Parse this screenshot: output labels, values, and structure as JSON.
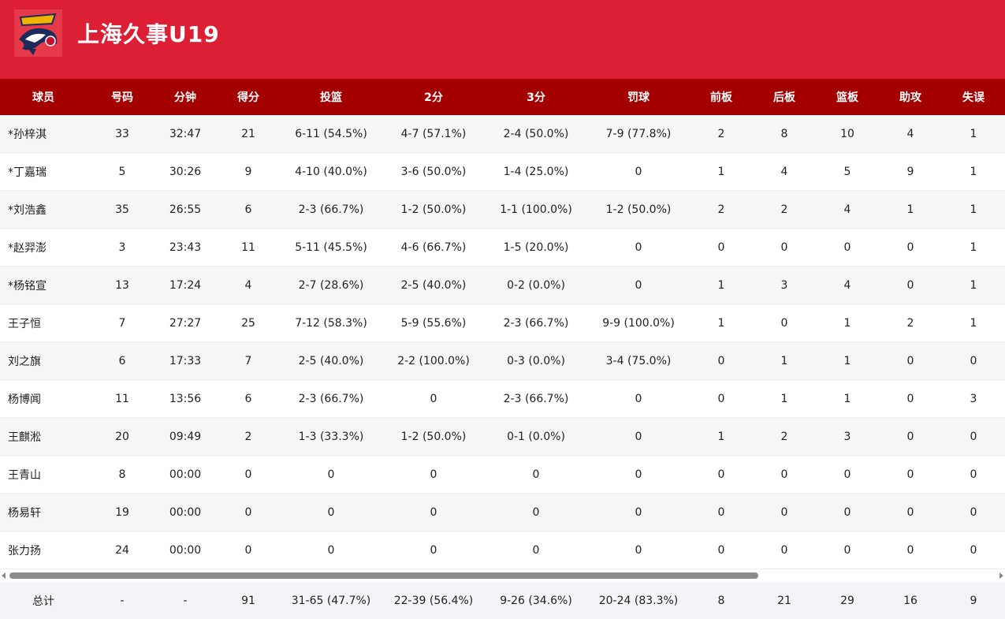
{
  "team": {
    "name": "上海久事U19",
    "logo_icon": "shark-logo-icon",
    "colors": {
      "header": "#dc1f34",
      "table_header": "#a40000"
    }
  },
  "columns": [
    "球员",
    "号码",
    "分钟",
    "得分",
    "投篮",
    "2分",
    "3分",
    "罚球",
    "前板",
    "后板",
    "篮板",
    "助攻",
    "失误"
  ],
  "players": [
    [
      "*孙梓淇",
      "33",
      "32:47",
      "21",
      "6-11 (54.5%)",
      "4-7 (57.1%)",
      "2-4 (50.0%)",
      "7-9 (77.8%)",
      "2",
      "8",
      "10",
      "4",
      "1"
    ],
    [
      "*丁嘉瑞",
      "5",
      "30:26",
      "9",
      "4-10 (40.0%)",
      "3-6 (50.0%)",
      "1-4 (25.0%)",
      "0",
      "1",
      "4",
      "5",
      "9",
      "1"
    ],
    [
      "*刘浩鑫",
      "35",
      "26:55",
      "6",
      "2-3 (66.7%)",
      "1-2 (50.0%)",
      "1-1 (100.0%)",
      "1-2 (50.0%)",
      "2",
      "2",
      "4",
      "1",
      "1"
    ],
    [
      "*赵羿澎",
      "3",
      "23:43",
      "11",
      "5-11 (45.5%)",
      "4-6 (66.7%)",
      "1-5 (20.0%)",
      "0",
      "0",
      "0",
      "0",
      "0",
      "1"
    ],
    [
      "*杨铭宣",
      "13",
      "17:24",
      "4",
      "2-7 (28.6%)",
      "2-5 (40.0%)",
      "0-2 (0.0%)",
      "0",
      "1",
      "3",
      "4",
      "0",
      "1"
    ],
    [
      "王子恒",
      "7",
      "27:27",
      "25",
      "7-12 (58.3%)",
      "5-9 (55.6%)",
      "2-3 (66.7%)",
      "9-9 (100.0%)",
      "1",
      "0",
      "1",
      "2",
      "1"
    ],
    [
      "刘之旗",
      "6",
      "17:33",
      "7",
      "2-5 (40.0%)",
      "2-2 (100.0%)",
      "0-3 (0.0%)",
      "3-4 (75.0%)",
      "0",
      "1",
      "1",
      "0",
      "0"
    ],
    [
      "杨博闻",
      "11",
      "13:56",
      "6",
      "2-3 (66.7%)",
      "0",
      "2-3 (66.7%)",
      "0",
      "0",
      "1",
      "1",
      "0",
      "3"
    ],
    [
      "王麒淞",
      "20",
      "09:49",
      "2",
      "1-3 (33.3%)",
      "1-2 (50.0%)",
      "0-1 (0.0%)",
      "0",
      "1",
      "2",
      "3",
      "0",
      "0"
    ],
    [
      "王青山",
      "8",
      "00:00",
      "0",
      "0",
      "0",
      "0",
      "0",
      "0",
      "0",
      "0",
      "0",
      "0"
    ],
    [
      "杨易轩",
      "19",
      "00:00",
      "0",
      "0",
      "0",
      "0",
      "0",
      "0",
      "0",
      "0",
      "0",
      "0"
    ],
    [
      "张力扬",
      "24",
      "00:00",
      "0",
      "0",
      "0",
      "0",
      "0",
      "0",
      "0",
      "0",
      "0",
      "0"
    ]
  ],
  "totals": [
    "总计",
    "-",
    "-",
    "91",
    "31-65 (47.7%)",
    "22-39 (56.4%)",
    "9-26 (34.6%)",
    "20-24 (83.3%)",
    "8",
    "21",
    "29",
    "16",
    "9"
  ]
}
